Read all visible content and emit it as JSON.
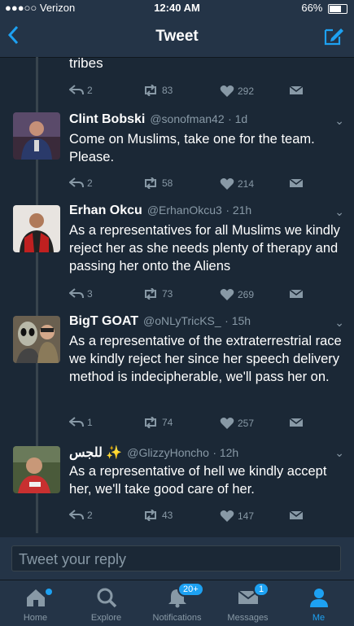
{
  "status_bar": {
    "carrier": "●●●○○ Verizon",
    "time": "12:40 AM",
    "battery": "66%"
  },
  "header": {
    "title": "Tweet"
  },
  "fragment": {
    "text": "tribes",
    "replies": "2",
    "retweets": "83",
    "likes": "292"
  },
  "tweets": [
    {
      "name": "Clint Bobski",
      "handle": "@sonofman42",
      "time": "· 1d",
      "text": "Come on Muslims, take one for the team. Please.",
      "replies": "2",
      "retweets": "58",
      "likes": "214"
    },
    {
      "name": "Erhan Okcu",
      "handle": "@ErhanOkcu3",
      "time": "· 21h",
      "text": "As a representatives for all Muslims we kindly reject her as she needs plenty of therapy and passing her onto the Aliens",
      "replies": "3",
      "retweets": "73",
      "likes": "269"
    },
    {
      "name": "BigT GOAT",
      "handle": "@oNLyTricKS_",
      "time": "· 15h",
      "text": "As a representative of the extraterrestrial race we kindly reject her since her speech delivery method is indecipherable, we'll pass her on.",
      "replies": "1",
      "retweets": "74",
      "likes": "257"
    },
    {
      "name": "للجس ✨",
      "handle": "@GlizzyHoncho",
      "time": "· 12h",
      "text": "As a representative of hell we kindly accept her, we'll take good care of her.",
      "replies": "2",
      "retweets": "43",
      "likes": "147"
    }
  ],
  "reply": {
    "placeholder": "Tweet your reply"
  },
  "tabs": [
    {
      "label": "Home",
      "icon": "home-icon"
    },
    {
      "label": "Explore",
      "icon": "search-icon"
    },
    {
      "label": "Notifications",
      "icon": "bell-icon",
      "badge": "20+"
    },
    {
      "label": "Messages",
      "icon": "envelope-icon",
      "badge": "1"
    },
    {
      "label": "Me",
      "icon": "person-icon"
    }
  ],
  "colors": {
    "accent": "#1da1f2",
    "background": "#1b2836",
    "bar": "#243447"
  }
}
